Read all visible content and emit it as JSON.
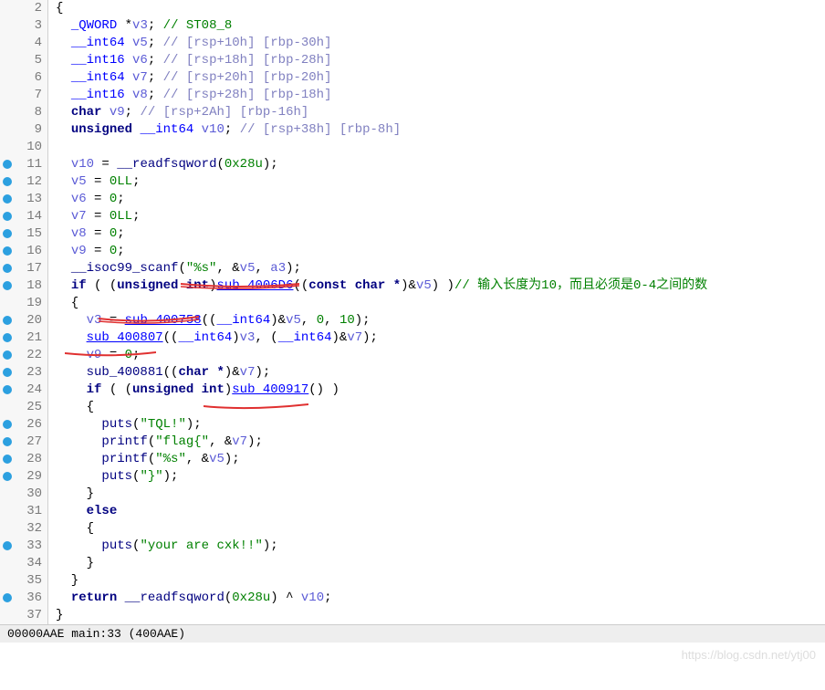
{
  "lines": {
    "2": "{",
    "3": {
      "type": "_QWORD",
      "name": "v3",
      "cmt": "// ST08_8"
    },
    "4": {
      "type": "__int64",
      "name": "v5",
      "cmt": "// [rsp+10h] [rbp-30h]"
    },
    "5": {
      "type": "__int16",
      "name": "v6",
      "cmt": "// [rsp+18h] [rbp-28h]"
    },
    "6": {
      "type": "__int64",
      "name": "v7",
      "cmt": "// [rsp+20h] [rbp-20h]"
    },
    "7": {
      "type": "__int16",
      "name": "v8",
      "cmt": "// [rsp+28h] [rbp-18h]"
    },
    "8": {
      "type": "char",
      "name": "v9",
      "cmt": "// [rsp+2Ah] [rbp-16h]"
    },
    "9": {
      "type1": "unsigned",
      "type2": "__int64",
      "name": "v10",
      "cmt": "// [rsp+38h] [rbp-8h]"
    },
    "11": {
      "lhs": "v10",
      "fn": "__readfsqword",
      "arg": "0x28u"
    },
    "12": {
      "lhs": "v5",
      "rhs": "0LL"
    },
    "13": {
      "lhs": "v6",
      "rhs": "0"
    },
    "14": {
      "lhs": "v7",
      "rhs": "0LL"
    },
    "15": {
      "lhs": "v8",
      "rhs": "0"
    },
    "16": {
      "lhs": "v9",
      "rhs": "0"
    },
    "17": {
      "fn": "__isoc99_scanf",
      "s": "\"%s\"",
      "a": "v5",
      "b": "a3"
    },
    "18": {
      "kw": "if",
      "cast": "unsigned int",
      "fn": "sub_4006D6",
      "castin": "const char *",
      "arg": "v5",
      "cmt": "// 输入长度为10，而且必须是0-4之间的数"
    },
    "20": {
      "lhs": "v3",
      "fn": "sub_400758",
      "cast": "__int64",
      "a": "v5",
      "b": "0",
      "c": "10"
    },
    "21": {
      "fn": "sub_400807",
      "cast1": "__int64",
      "a": "v3",
      "cast2": "__int64",
      "b": "v7"
    },
    "22": {
      "lhs": "v9",
      "rhs": "0"
    },
    "23": {
      "fn": "sub_400881",
      "cast": "char *",
      "a": "v7"
    },
    "24": {
      "kw": "if",
      "cast": "unsigned int",
      "fn": "sub_400917"
    },
    "26": {
      "fn": "puts",
      "s": "\"TQL!\""
    },
    "27": {
      "fn": "printf",
      "s": "\"flag{\"",
      "a": "v7"
    },
    "28": {
      "fn": "printf",
      "s": "\"%s\"",
      "a": "v5"
    },
    "29": {
      "fn": "puts",
      "s": "\"}\""
    },
    "31": {
      "kw": "else"
    },
    "33": {
      "fn": "puts",
      "s": "\"your are cxk!!\""
    },
    "36": {
      "kw": "return",
      "fn": "__readfsqword",
      "arg": "0x28u",
      "xor": "v10"
    }
  },
  "breakpoints": [
    11,
    12,
    13,
    14,
    15,
    16,
    17,
    18,
    20,
    21,
    22,
    23,
    24,
    26,
    27,
    28,
    29,
    33,
    36
  ],
  "status": "00000AAE main:33 (400AAE)",
  "watermark": "https://blog.csdn.net/ytj00"
}
